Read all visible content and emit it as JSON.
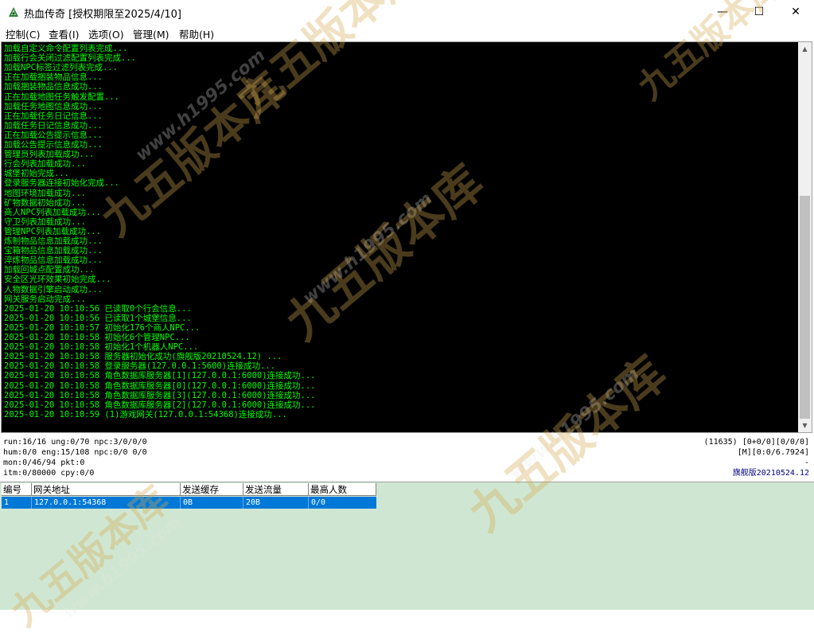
{
  "window": {
    "title": "热血传奇 [授权期限至2025/4/10]",
    "controls": {
      "minimize": "—",
      "maximize": "☐",
      "close": "✕"
    }
  },
  "menu": [
    {
      "label": "控制(C)"
    },
    {
      "label": "查看(I)"
    },
    {
      "label": "选项(O)"
    },
    {
      "label": "管理(M)"
    },
    {
      "label": "帮助(H)"
    }
  ],
  "console": {
    "text_color": "#00ff00",
    "background": "#000000",
    "lines": [
      "加载自定义命令配置列表完成...",
      "加载行会关闭过滤配置列表完成...",
      "加载NPC标签过滤列表完成...",
      "正在加载捆装物品信息...",
      "加载捆装物品信息成功...",
      "正在加载地图任务触发配置...",
      "加载任务地图信息成功...",
      "正在加载任务日记信息...",
      "加载任务日记信息成功...",
      "正在加载公告提示信息...",
      "加载公告提示信息成功...",
      "管理员列表加载成功...",
      "行会列表加载成功...",
      "城堡初始完成...",
      "登录服务器连接初始化完成...",
      "地图环境加载成功...",
      "矿物数据初始成功...",
      "商人NPC列表加载成功...",
      "守卫列表加载成功...",
      "管理NPC列表加载成功...",
      "炼制物品信息加载成功...",
      "宝箱物品信息加载成功...",
      "淬炼物品信息加载成功...",
      "加载回城点配置成功...",
      "安全区光环效果初始完成...",
      "人物数据引擎启动成功...",
      "网关服务启动完成...",
      "2025-01-20 10:10:56 已读取0个行会信息...",
      "2025-01-20 10:10:56 已读取1个城堡信息...",
      "2025-01-20 10:10:57 初始化176个商人NPC...",
      "2025-01-20 10:10:58 初始化6个管理NPC...",
      "2025-01-20 10:10:58 初始化1个机器人NPC...",
      "2025-01-20 10:10:58 服务器初始化成功(旗舰版20210524.12) ...",
      "2025-01-20 10:10:58 登录服务器(127.0.0.1:5600)连接成功...",
      "2025-01-20 10:10:58 角色数据库服务器[1](127.0.0.1:6000)连接成功...",
      "2025-01-20 10:10:58 角色数据库服务器[0](127.0.0.1:6000)连接成功...",
      "2025-01-20 10:10:58 角色数据库服务器[3](127.0.0.1:6000)连接成功...",
      "2025-01-20 10:10:58 角色数据库服务器[2](127.0.0.1:6000)连接成功...",
      "2025-01-20 10:10:59 (1)游戏网关(127.0.0.1:54368)连接成功..."
    ]
  },
  "status": {
    "left": [
      "run:16/16 ung:0/70 npc:3/0/0/0",
      "hum:0/0 eng:15/108 npc:0/0 0/0",
      "mon:0/46/94 pkt:0",
      "itm:0/80000 cpy:0/0"
    ],
    "right": [
      "(11635) [0+0/0][0/0/0]",
      "[M][0:0/6.7924]",
      "-",
      "旗舰版20210524.12"
    ],
    "version_color": "#000080"
  },
  "gateway_table": {
    "columns": [
      "编号",
      "网关地址",
      "发送缓存",
      "发送流量",
      "最高人数"
    ],
    "rows": [
      [
        "1",
        "127.0.0.1:54368",
        "0B",
        "20B",
        "0/0"
      ]
    ],
    "selected_color": "#0078d7",
    "area_color": "#cfe7d2"
  },
  "watermarks": {
    "brand": "九五版本库",
    "url": "www.h1995.com",
    "icons": [
      "app-icon"
    ]
  }
}
